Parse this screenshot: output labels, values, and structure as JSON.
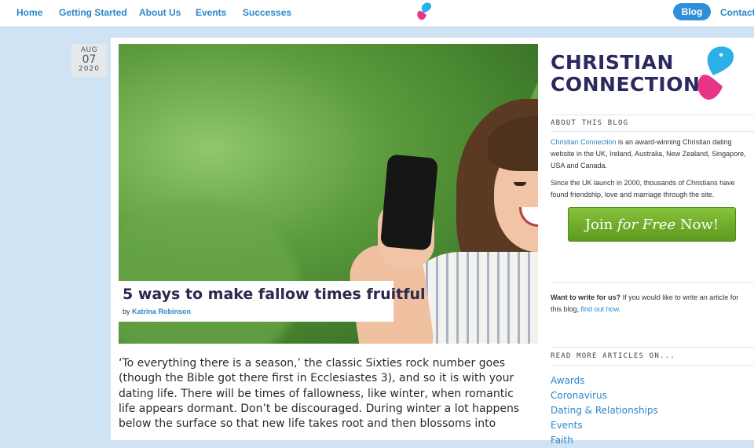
{
  "nav": {
    "items": [
      {
        "label": "Home"
      },
      {
        "label": "Getting Started"
      },
      {
        "label": "About Us"
      },
      {
        "label": "Events"
      },
      {
        "label": "Successes"
      }
    ],
    "blog_label": "Blog",
    "contact_label": "Contact",
    "logo_icon": "christian-connection-hearts-icon"
  },
  "post": {
    "date": {
      "month": "AUG",
      "day": "07",
      "year": "2020"
    },
    "title": "5 ways to make fallow times fruitful",
    "by_label": "by",
    "author": "Katrina Robinson",
    "body": "‘To everything there is a season,’ the classic Sixties rock number goes (though the Bible got there first in Ecclesiastes 3), and so it is with your dating life. There will be times of fallowness, like winter, when romantic life appears dormant. Don’t be discouraged. During winter a lot happens below the surface so that new life takes root and then blossoms into"
  },
  "sidebar": {
    "logo_line1": "CHRISTIAN",
    "logo_line2": "CONNECTION",
    "about_heading": "ABOUT THIS BLOG",
    "about_link": "Christian Connection",
    "about_p1_rest": " is an award-winning Christian dating website in the UK, Ireland, Australia, New Zealand, Singapore, USA and Canada.",
    "about_p2": "Since the UK launch in 2000, thousands of Christians have found friendship, love and marriage through the site.",
    "join": {
      "pre": "Join ",
      "em": "for Free",
      "post": " Now!"
    },
    "write_bold": "Want to write for us?",
    "write_rest": " If you would like to write an article for this blog, ",
    "write_link": "find out how",
    "write_end": ".",
    "read_more_heading": "READ MORE ARTICLES ON...",
    "categories": [
      "Awards",
      "Coronavirus",
      "Dating & Relationships",
      "Events",
      "Faith"
    ]
  },
  "colors": {
    "accent_blue": "#2a87c8",
    "brand_navy": "#2b2a5e",
    "heart_blue": "#2bb0e8",
    "heart_pink": "#e8358a",
    "join_green": "#6aab28",
    "page_bg": "#cfe3f5"
  }
}
